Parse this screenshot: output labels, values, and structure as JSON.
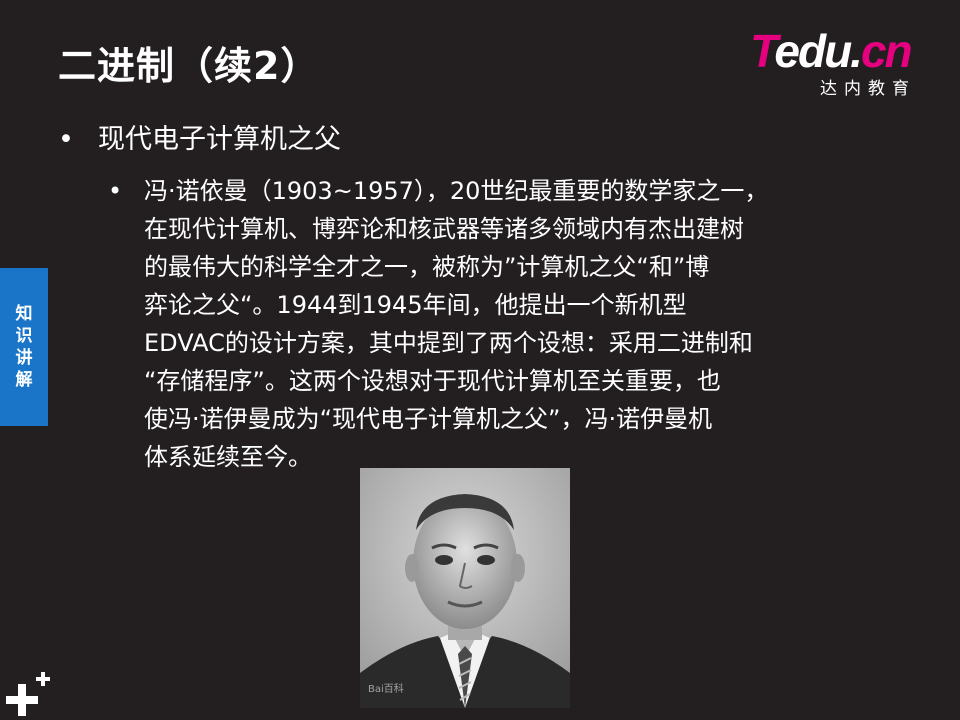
{
  "slide": {
    "title": "二进制（续2）",
    "bullet_level1": "现代电子计算机之父",
    "bullet_level2_lines": [
      "冯·诺依曼（1903~1957），20世纪最重要的数学家之一，",
      "在现代计算机、博弈论和核武器等诸多领域内有杰出建树",
      "的最伟大的科学全才之一，被称为”计算机之父“和”博",
      "弈论之父“。1944到1945年间，他提出一个新机型",
      "EDVAC的设计方案，其中提到了两个设想：采用二进制和",
      "“存储程序”。这两个设想对于现代计算机至关重要，也",
      "使冯·诺伊曼成为“现代电子计算机之父”，冯·诺伊曼机",
      "体系延续至今。"
    ],
    "bullet_glyph": "•"
  },
  "logo": {
    "brand_t": "T",
    "brand_mid": "edu.",
    "brand_cn": "cn",
    "subtitle": "达内教育"
  },
  "side_tab": {
    "chars": [
      "知",
      "识",
      "讲",
      "解"
    ]
  },
  "photo": {
    "watermark": "Bai百科"
  },
  "colors": {
    "background": "#231f20",
    "text": "#ffffff",
    "brand_magenta": "#e4007f",
    "side_tab_blue": "#1a75c8"
  },
  "icons": {
    "corner": "plus-cluster-icon"
  }
}
